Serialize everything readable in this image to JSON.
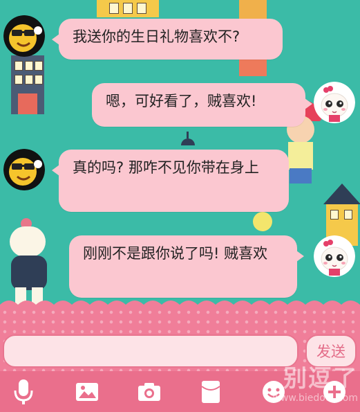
{
  "messages": [
    {
      "side": "left",
      "text": "我送你的生日礼物喜欢不?"
    },
    {
      "side": "right",
      "text": "嗯，可好看了，贼喜欢!"
    },
    {
      "side": "left",
      "text": "真的吗? 那咋不见你带在身上"
    },
    {
      "side": "right",
      "text": "刚刚不是跟你说了吗! 贼喜欢"
    }
  ],
  "input": {
    "value": "",
    "placeholder": ""
  },
  "send_label": "发送",
  "toolbar": {
    "items": [
      "microphone-icon",
      "image-icon",
      "camera-icon",
      "red-envelope-icon",
      "emoji-icon",
      "plus-icon"
    ]
  },
  "watermark": {
    "text": "别逗了",
    "url": "www.biedoul.com"
  },
  "colors": {
    "background": "#3bbba7",
    "bubble": "#fbc7d0",
    "input_bar": "#f07e99",
    "toolbar": "#ea6f8c"
  }
}
